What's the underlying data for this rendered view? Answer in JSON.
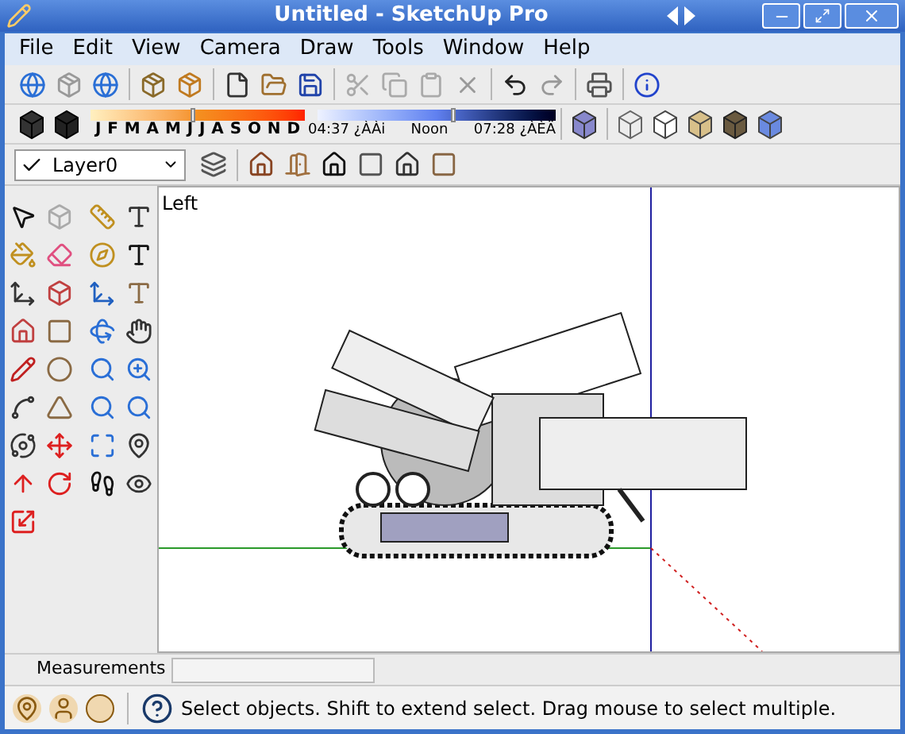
{
  "window": {
    "title": "Untitled - SketchUp Pro"
  },
  "menu": [
    "File",
    "Edit",
    "View",
    "Camera",
    "Draw",
    "Tools",
    "Window",
    "Help"
  ],
  "shadow_settings": {
    "months": [
      "J",
      "F",
      "M",
      "A",
      "M",
      "J",
      "J",
      "A",
      "S",
      "O",
      "N",
      "D"
    ],
    "date_slider": {
      "level": 0.47
    },
    "time_start": "04:37 ¿ÀÀi",
    "time_mid": "Noon",
    "time_end": "07:28 ¿ÀÈÄ",
    "time_slider": {
      "level": 0.56
    }
  },
  "layer": {
    "value": "Layer0"
  },
  "viewport": {
    "view_label": "Left"
  },
  "measurements": {
    "label": "Measurements"
  },
  "status_bar": {
    "message": "Select objects. Shift to extend select. Drag mouse to select multiple."
  }
}
